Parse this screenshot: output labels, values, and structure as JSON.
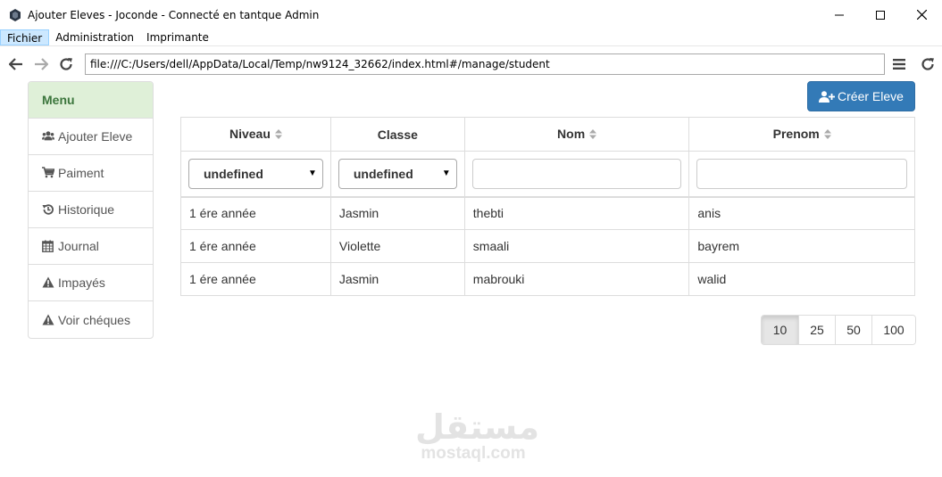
{
  "window": {
    "title": "Ajouter Eleves - Joconde - Connecté en tantque Admin"
  },
  "menubar": {
    "items": [
      "Fichier",
      "Administration",
      "Imprimante"
    ]
  },
  "navbar": {
    "url": "file:///C:/Users/dell/AppData/Local/Temp/nw9124_32662/index.html#/manage/student"
  },
  "sidebar": {
    "header": "Menu",
    "items": [
      {
        "label": "Ajouter Eleve",
        "icon": "users-icon"
      },
      {
        "label": "Paiment",
        "icon": "cart-icon"
      },
      {
        "label": "Historique",
        "icon": "history-icon"
      },
      {
        "label": "Journal",
        "icon": "calendar-icon"
      },
      {
        "label": "Impayés",
        "icon": "warning-icon"
      },
      {
        "label": "Voir chéques",
        "icon": "warning-icon"
      }
    ]
  },
  "main": {
    "create_button": "Créer Eleve",
    "columns": [
      "Niveau",
      "Classe",
      "Nom",
      "Prenom"
    ],
    "filters": {
      "niveau": "undefined",
      "classe": "undefined",
      "nom": "",
      "prenom": ""
    },
    "rows": [
      [
        "1 ére année",
        "Jasmin",
        "thebti",
        "anis"
      ],
      [
        "1 ére année",
        "Violette",
        "smaali",
        "bayrem"
      ],
      [
        "1 ére année",
        "Jasmin",
        "mabrouki",
        "walid"
      ]
    ],
    "page_sizes": [
      "10",
      "25",
      "50",
      "100"
    ],
    "selected_page_size": "10"
  },
  "watermark": {
    "arabic": "مستقل",
    "latin": "mostaql.com"
  },
  "colors": {
    "primary": "#337ab7",
    "sidebar_header_bg": "#dff0d8",
    "sidebar_header_text": "#3c763d"
  }
}
